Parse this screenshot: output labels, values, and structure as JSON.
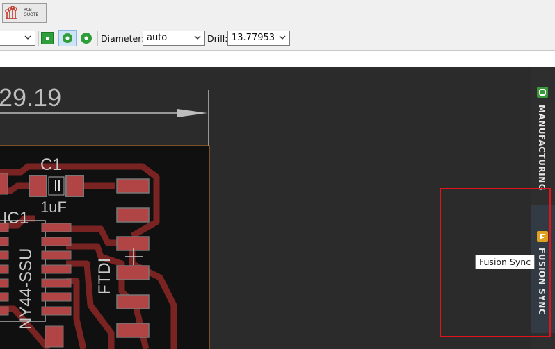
{
  "toolbar": {
    "pcb_quote_label_line1": "PCB",
    "pcb_quote_label_line2": "QUOTE"
  },
  "via_toolbar": {
    "diameter_label": "Diameter:",
    "diameter_value": "auto",
    "drill_label": "Drill:",
    "drill_value": "13.77953"
  },
  "board": {
    "dimension_text": "29.19",
    "c1_name": "C1",
    "c1_value": "1uF",
    "ic1_name": "IC1",
    "ic1_value": "NY44-SSU",
    "connector_name": "FTDI"
  },
  "side_panel": {
    "manufacturing_label": "MANUFACTURING",
    "fusion_sync_label": "FUSION SYNC"
  },
  "tooltip": {
    "text": "Fusion Sync"
  },
  "colors": {
    "canvas": "#2b2b2b",
    "trace": "#7a2323",
    "pad": "#b14545",
    "silk": "#c8c8c8",
    "highlight": "#e0141a"
  }
}
